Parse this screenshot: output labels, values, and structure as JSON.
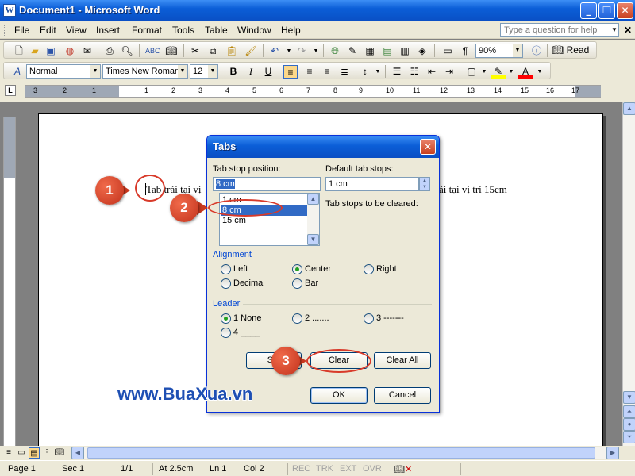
{
  "window": {
    "title": "Document1 - Microsoft Word",
    "app_icon": "W"
  },
  "menu": {
    "items": [
      "File",
      "Edit",
      "View",
      "Insert",
      "Format",
      "Tools",
      "Table",
      "Window",
      "Help"
    ],
    "question_placeholder": "Type a question for help"
  },
  "toolbar": {
    "zoom": "90%",
    "read_label": "Read",
    "style": "Normal",
    "font": "Times New Roman",
    "size": "12"
  },
  "ruler": {
    "numbers": [
      "3",
      "2",
      "1",
      "1",
      "2",
      "3",
      "4",
      "5",
      "6",
      "7",
      "8",
      "9",
      "10",
      "11",
      "12",
      "13",
      "14",
      "15",
      "16",
      "17"
    ]
  },
  "document": {
    "text_left": "Tab trái tại vị",
    "text_right": "phải tại vị trí 15cm"
  },
  "dialog": {
    "title": "Tabs",
    "tab_stop_position_label": "Tab stop position:",
    "tab_stop_position_value": "8 cm",
    "default_tab_stops_label": "Default tab stops:",
    "default_tab_stops_value": "1 cm",
    "tab_stops_cleared_label": "Tab stops to be cleared:",
    "tab_stops": [
      "1 cm",
      "8 cm",
      "15 cm"
    ],
    "selected_tab_stop": "8 cm",
    "alignment_title": "Alignment",
    "alignment": {
      "left": "Left",
      "center": "Center",
      "right": "Right",
      "decimal": "Decimal",
      "bar": "Bar",
      "selected": "Center"
    },
    "leader_title": "Leader",
    "leader": {
      "opt1": "1 None",
      "opt2": "2 .......",
      "opt3": "3 -------",
      "opt4": "4 ____",
      "selected": "1 None"
    },
    "buttons": {
      "set": "Set",
      "clear": "Clear",
      "clear_all": "Clear All",
      "ok": "OK",
      "cancel": "Cancel"
    }
  },
  "annotations": {
    "step1": "1",
    "step2": "2",
    "step3": "3",
    "watermark": "www.BuaXua.vn"
  },
  "status": {
    "page": "Page 1",
    "sec": "Sec 1",
    "page_of": "1/1",
    "at": "At 2.5cm",
    "ln": "Ln 1",
    "col": "Col 2",
    "rec": "REC",
    "trk": "TRK",
    "ext": "EXT",
    "ovr": "OVR"
  },
  "colors": {
    "titlebar": "#0b5ed7",
    "annotation": "#d83a2a",
    "selection": "#316ac5",
    "chrome": "#ece9d8"
  }
}
